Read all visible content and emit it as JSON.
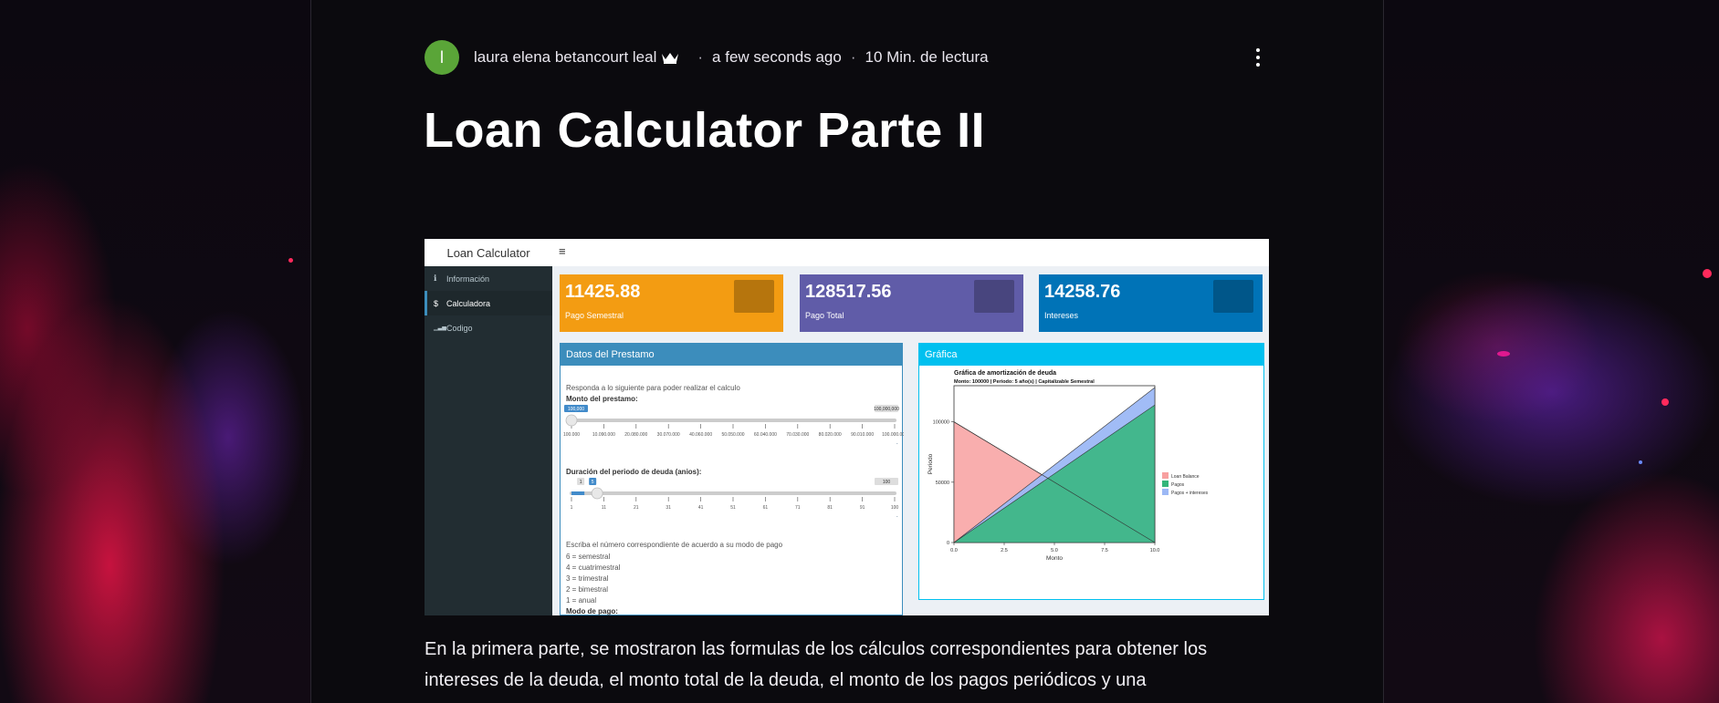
{
  "post": {
    "avatar_initial": "l",
    "author": "laura elena betancourt leal",
    "time_ago": "a few seconds ago",
    "read_time": "10 Min. de lectura",
    "title": "Loan Calculator Parte II",
    "body": "En la primera parte, se mostraron las formulas de los cálculos correspondientes para obtener los intereses de la deuda, el monto total de la deuda, el monto de los pagos periódicos y una"
  },
  "screenshot": {
    "brand": "Loan Calculator",
    "menu_icon": "hamburger-icon",
    "sidebar": [
      {
        "icon": "info-icon",
        "glyph": "ℹ",
        "label": "Información"
      },
      {
        "icon": "dollar-icon",
        "glyph": "$",
        "label": "Calculadora"
      },
      {
        "icon": "signal-icon",
        "glyph": "▁▃▅",
        "label": "Codigo"
      }
    ],
    "value_boxes": [
      {
        "value": "11425.88",
        "label": "Pago Semestral",
        "color": "#f39c12"
      },
      {
        "value": "128517.56",
        "label": "Pago Total",
        "color": "#605ca8"
      },
      {
        "value": "14258.76",
        "label": "Intereses",
        "color": "#0073b7"
      }
    ],
    "form_box": {
      "header": "Datos del Prestamo",
      "header_color": "#3c8dbc",
      "intro": "Responda a lo siguiente para poder realizar el calculo",
      "slider1": {
        "label": "Monto del prestamo:",
        "min_label": "100,000",
        "max_label": "100,000,000",
        "ticks": [
          "100.000",
          "10.090.000",
          "20.080.000",
          "30.070.000",
          "40.060.000",
          "50.050.000",
          "60.040.000",
          "70.030.000",
          "80.020.000",
          "90.010.000",
          "100.000.000"
        ],
        "value_fraction": 0.0
      },
      "slider2": {
        "label": "Duración del periodo de deuda (anios):",
        "min_label": "1",
        "value_label": "5",
        "max_label": "100",
        "ticks": [
          "1",
          "11",
          "21",
          "31",
          "41",
          "51",
          "61",
          "71",
          "81",
          "91",
          "100"
        ],
        "value_fraction": 0.04
      },
      "pay_intro": "Escriba el número correspondiente de acuerdo a su modo de pago",
      "pay_options": [
        "6 = semestral",
        "4 = cuatrimestral",
        "3 = trimestral",
        "2 = bimestral",
        "1 = anual"
      ],
      "pay_label": "Modo de pago:"
    },
    "chart_box": {
      "header": "Gráfica",
      "header_color": "#00c0ef"
    }
  },
  "chart_data": {
    "type": "area",
    "title": "Gráfica de amortización de deuda",
    "subtitle": "Monto:  100000 | Periodo:  5  año(s) | Capitalizable  Semestral",
    "xlabel": "Monto",
    "ylabel": "Periodo",
    "xlim": [
      0,
      10
    ],
    "ylim": [
      0,
      130000
    ],
    "x_ticks": [
      "0.0",
      "2.5",
      "5.0",
      "7.5",
      "10.0"
    ],
    "y_ticks": [
      "0",
      "50000",
      "100000"
    ],
    "x": [
      0,
      10
    ],
    "series": [
      {
        "name": "Loan Balance",
        "values": [
          100000,
          0
        ],
        "color": "#f8a0a0"
      },
      {
        "name": "Pagos",
        "values": [
          0,
          114000
        ],
        "color": "#33b67a"
      },
      {
        "name": "Pagos + intereses",
        "values": [
          0,
          128500
        ],
        "color": "#9cb8f5"
      }
    ],
    "legend": "right"
  }
}
